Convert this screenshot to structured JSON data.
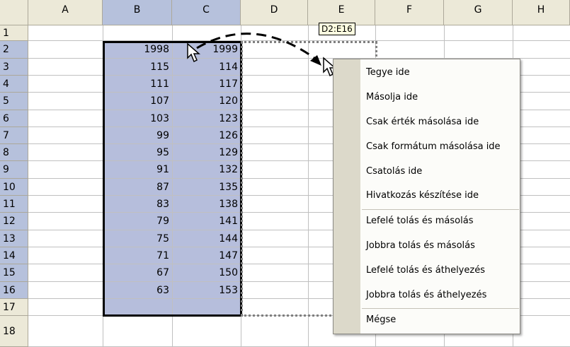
{
  "columns": [
    "A",
    "B",
    "C",
    "D",
    "E",
    "F",
    "G",
    "H"
  ],
  "rows": [
    "1",
    "2",
    "3",
    "4",
    "5",
    "6",
    "7",
    "8",
    "9",
    "10",
    "11",
    "12",
    "13",
    "14",
    "15",
    "16",
    "17",
    "18"
  ],
  "table": {
    "b": [
      "1998",
      "115",
      "111",
      "107",
      "103",
      "99",
      "95",
      "91",
      "87",
      "83",
      "79",
      "75",
      "71",
      "67",
      "63"
    ],
    "c": [
      "1999",
      "114",
      "117",
      "120",
      "123",
      "126",
      "129",
      "132",
      "135",
      "138",
      "141",
      "144",
      "147",
      "150",
      "153"
    ]
  },
  "tooltip": "D2:E16",
  "menu": {
    "items": [
      "Tegye ide",
      "Másolja ide",
      "Csak érték másolása ide",
      "Csak formátum másolása ide",
      "Csatolás ide",
      "Hivatkozás készítése ide",
      "Lefelé tolás és másolás",
      "Jobbra tolás és másolás",
      "Lefelé tolás és áthelyezés",
      "Jobbra tolás és áthelyezés",
      "Mégse"
    ]
  },
  "colors": {
    "header": "#ece9d8",
    "selection": "#b6bedc",
    "menu_gutter": "#dcd9ca"
  }
}
